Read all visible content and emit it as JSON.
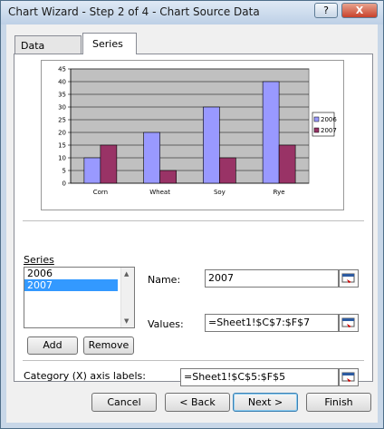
{
  "window": {
    "title": "Chart Wizard - Step 2 of 4 - Chart Source Data",
    "help_label": "?",
    "close_label": "X"
  },
  "tabs": [
    {
      "label": "Data Range"
    },
    {
      "label": "Series"
    }
  ],
  "chart_data": {
    "type": "bar",
    "categories": [
      "Corn",
      "Wheat",
      "Soy",
      "Rye"
    ],
    "series": [
      {
        "name": "2006",
        "values": [
          10,
          20,
          30,
          40
        ],
        "color": "#9999ff"
      },
      {
        "name": "2007",
        "values": [
          15,
          5,
          10,
          15
        ],
        "color": "#993366"
      }
    ],
    "ylim": [
      0,
      45
    ],
    "yticks": [
      "0",
      "5",
      "10",
      "15",
      "20",
      "25",
      "30",
      "35",
      "40",
      "45"
    ],
    "grid": true,
    "plot_background": "#c0c0c0",
    "legend_position": "right"
  },
  "series_section": {
    "label": "Series",
    "items": [
      "2006",
      "2007"
    ],
    "selected": "2007",
    "add_label": "Add",
    "remove_label": "Remove"
  },
  "name_field": {
    "label": "Name:",
    "value": "2007"
  },
  "values_field": {
    "label": "Values:",
    "value": "=Sheet1!$C$7:$F$7"
  },
  "category_field": {
    "label": "Category (X) axis labels:",
    "value": "=Sheet1!$C$5:$F$5"
  },
  "buttons": {
    "cancel": "Cancel",
    "back": "< Back",
    "next": "Next >",
    "finish": "Finish"
  }
}
